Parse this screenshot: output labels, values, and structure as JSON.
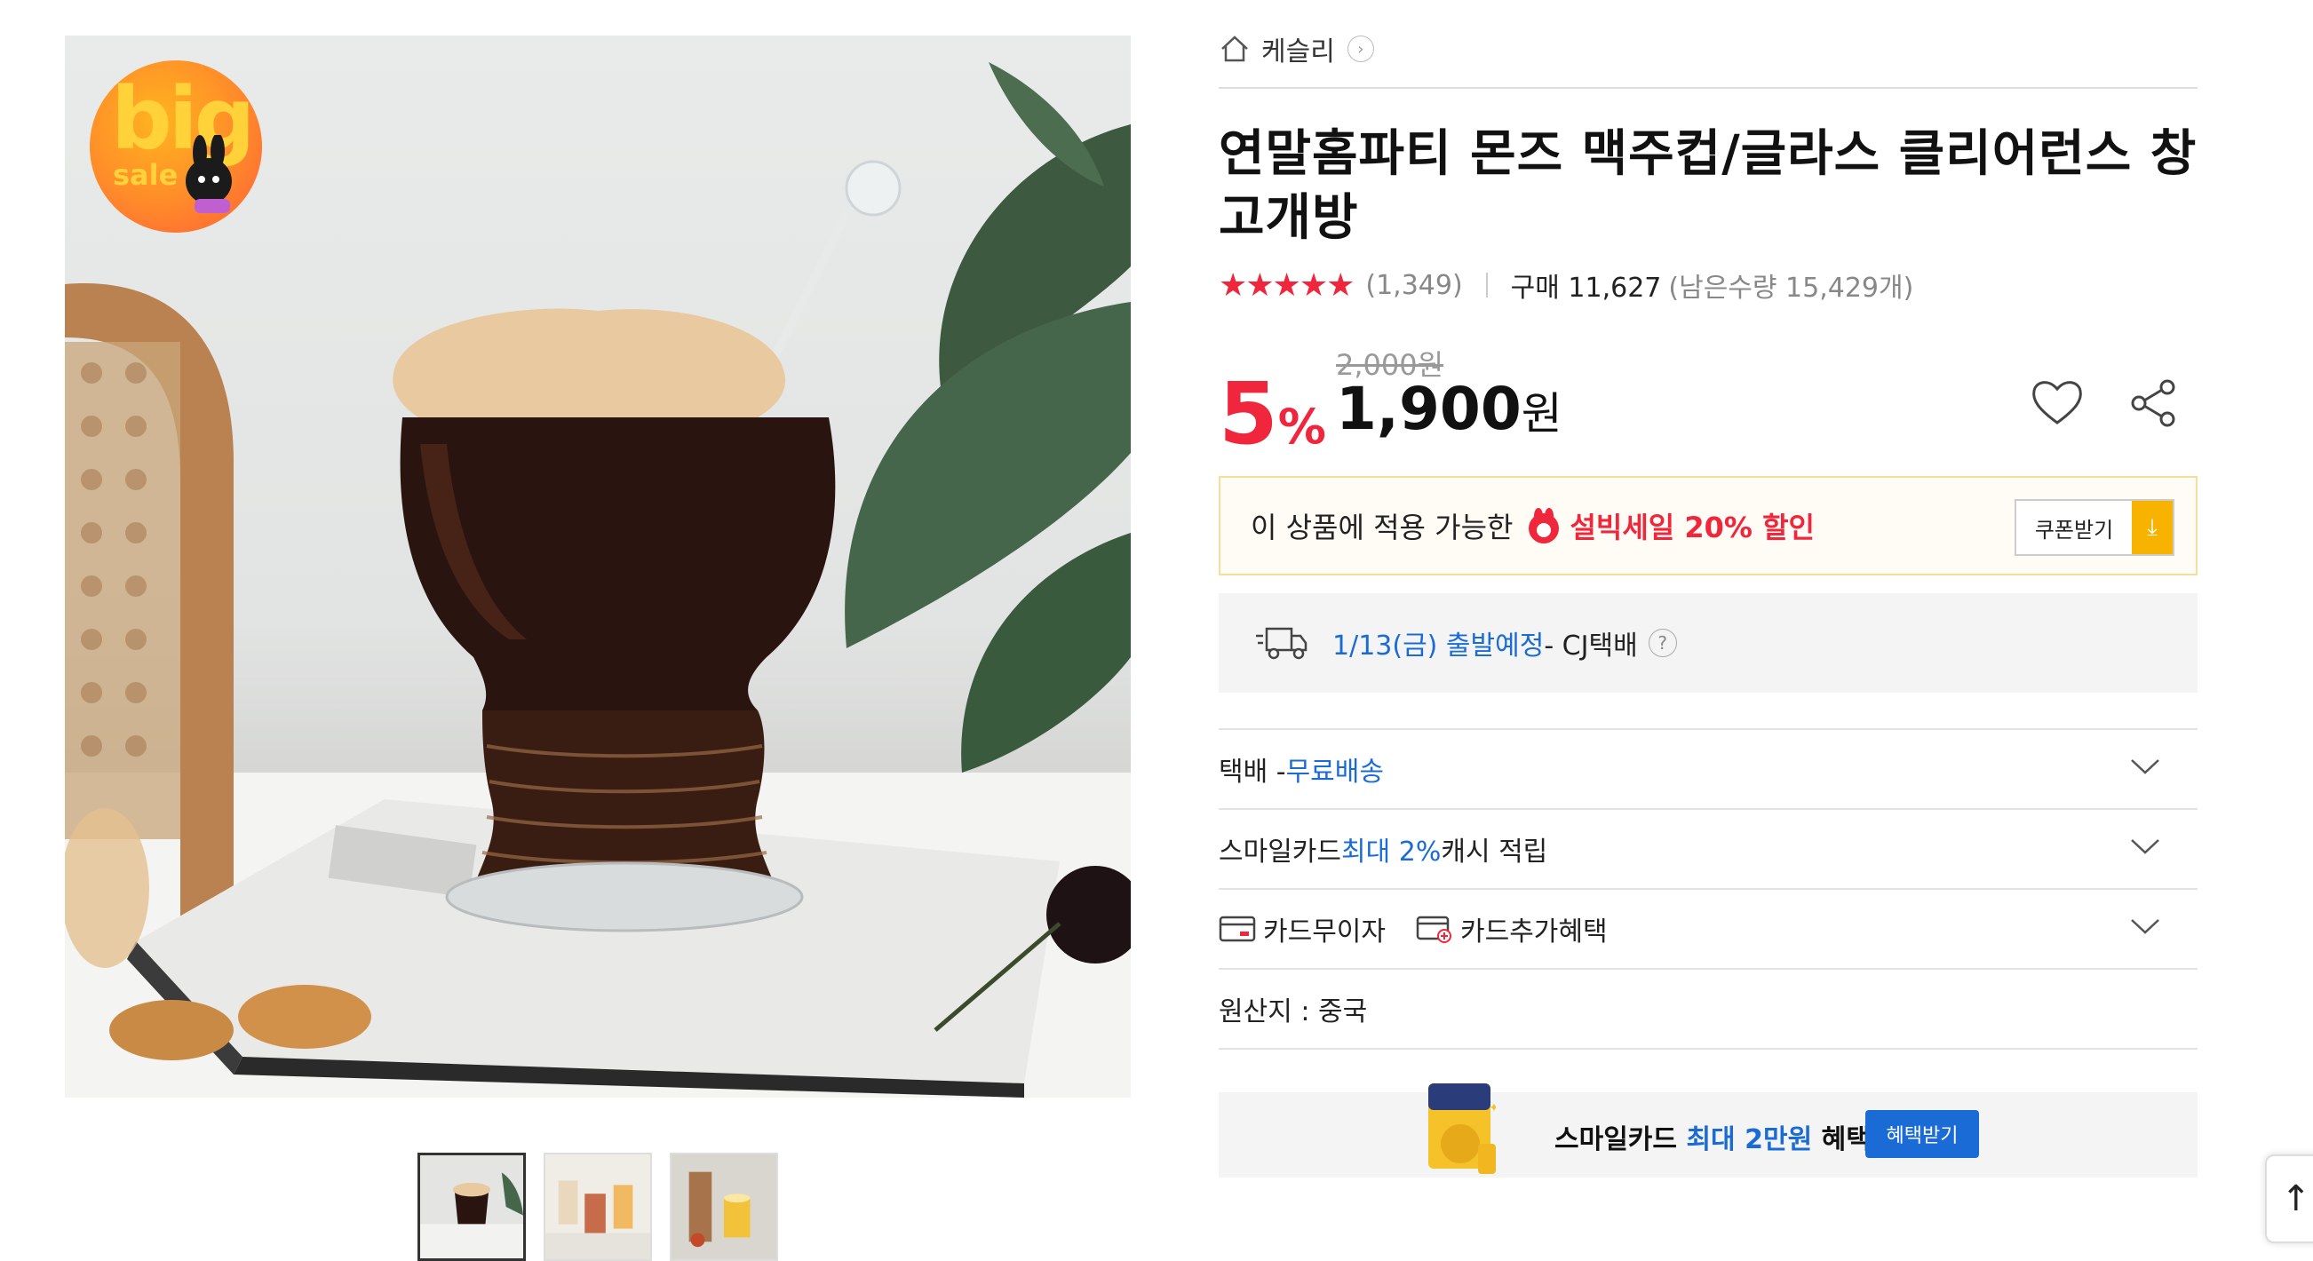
{
  "breadcrumb": {
    "store": "케슬리"
  },
  "product": {
    "title": "연말홈파티 몬즈 맥주컵/글라스 클리어런스 창고개방",
    "rating_stars": "★★★★★",
    "review_count": "(1,349)",
    "purchase_label": "구매 11,627",
    "stock": "(남은수량 15,429개)"
  },
  "badge": {
    "line1": "big",
    "line2": "sale"
  },
  "price": {
    "discount_num": "5",
    "discount_pct": "%",
    "original": "2,000원",
    "current_num": "1,900",
    "current_unit": "원"
  },
  "coupon": {
    "prefix": "이 상품에 적용 가능한",
    "highlight": "설빅세일 20% 할인",
    "button": "쿠폰받기"
  },
  "shipping": {
    "date": "1/13(금) 출발예정",
    "carrier": " - CJ택배"
  },
  "rows": {
    "delivery_prefix": "택배 - ",
    "delivery_value": "무료배송",
    "smile_prefix": "스마일카드 ",
    "smile_value": "최대 2%",
    "smile_suffix": " 캐시 적립",
    "card_interest": "카드무이자",
    "card_benefit": "카드추가혜택",
    "origin": "원산지 : 중국"
  },
  "banner": {
    "prefix": "스마일카드 ",
    "highlight": "최대 2만원",
    "suffix": " 혜택!",
    "button": "혜택받기"
  },
  "colors": {
    "accent_red": "#f0273c",
    "accent_blue": "#1a6bd6",
    "coupon_yellow": "#f7b300"
  }
}
